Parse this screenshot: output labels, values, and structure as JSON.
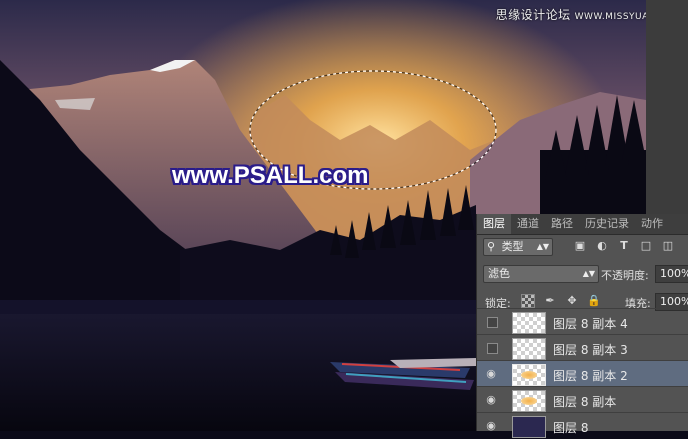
{
  "watermark": {
    "text": "思缘设计论坛",
    "site": "WWW.MISSYUAN.COM"
  },
  "image_text": "www.PSALL.com",
  "panel": {
    "tabs": [
      "图层",
      "通道",
      "路径",
      "历史记录",
      "动作"
    ],
    "active_tab": 0,
    "filter": {
      "label": "类型",
      "icon": "search-icon"
    },
    "blend_mode": "滤色",
    "opacity_label": "不透明度:",
    "opacity_value": "100%",
    "lock_label": "锁定:",
    "fill_label": "填充:",
    "fill_value": "100%",
    "layers": [
      {
        "name": "图层 8 副本 4",
        "visible": false,
        "selected": false
      },
      {
        "name": "图层 8 副本 3",
        "visible": false,
        "selected": false
      },
      {
        "name": "图层 8 副本 2",
        "visible": true,
        "selected": true
      },
      {
        "name": "图层 8 副本",
        "visible": true,
        "selected": false
      },
      {
        "name": "图层 8",
        "visible": true,
        "selected": false
      }
    ]
  },
  "colors": {
    "panel_bg": "#535353",
    "selected_row": "#5f6c80",
    "tab_bar": "#3e3e3e",
    "logo_outline": "#2a1c8a"
  }
}
